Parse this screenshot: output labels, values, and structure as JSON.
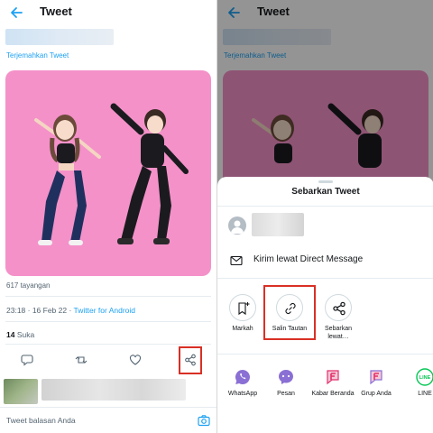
{
  "left": {
    "header": {
      "title": "Tweet"
    },
    "translate_label": "Terjemahkan Tweet",
    "views_label": "617 tayangan",
    "timestamp": "23:18 · 16 Feb 22 · ",
    "source": "Twitter for Android",
    "likes_count": "14",
    "likes_label": " Suka",
    "reply_placeholder": "Tweet balasan Anda"
  },
  "right": {
    "header": {
      "title": "Tweet"
    },
    "translate_label": "Terjemahkan Tweet",
    "sheet": {
      "title": "Sebarkan Tweet",
      "dm_label": "Kirim lewat Direct Message",
      "options": [
        {
          "label": "Markah",
          "icon": "bookmark-add-icon"
        },
        {
          "label": "Salin Tautan",
          "icon": "link-icon"
        },
        {
          "label": "Sebarkan lewat…",
          "icon": "share-icon"
        }
      ],
      "apps": [
        {
          "label": "WhatsApp",
          "icon": "whatsapp-icon"
        },
        {
          "label": "Pesan",
          "icon": "messages-icon"
        },
        {
          "label": "Kabar Beranda",
          "icon": "kabar-beranda-icon"
        },
        {
          "label": "Grup Anda",
          "icon": "grup-anda-icon"
        },
        {
          "label": "LINE",
          "icon": "line-icon"
        }
      ]
    }
  },
  "colors": {
    "accent": "#1da1f2",
    "highlight_box": "#d93025",
    "media_background": "#f491c9",
    "messenger_purple": "#8a6fd4",
    "facebook_red": "#e1306c",
    "line_green": "#06c755"
  }
}
